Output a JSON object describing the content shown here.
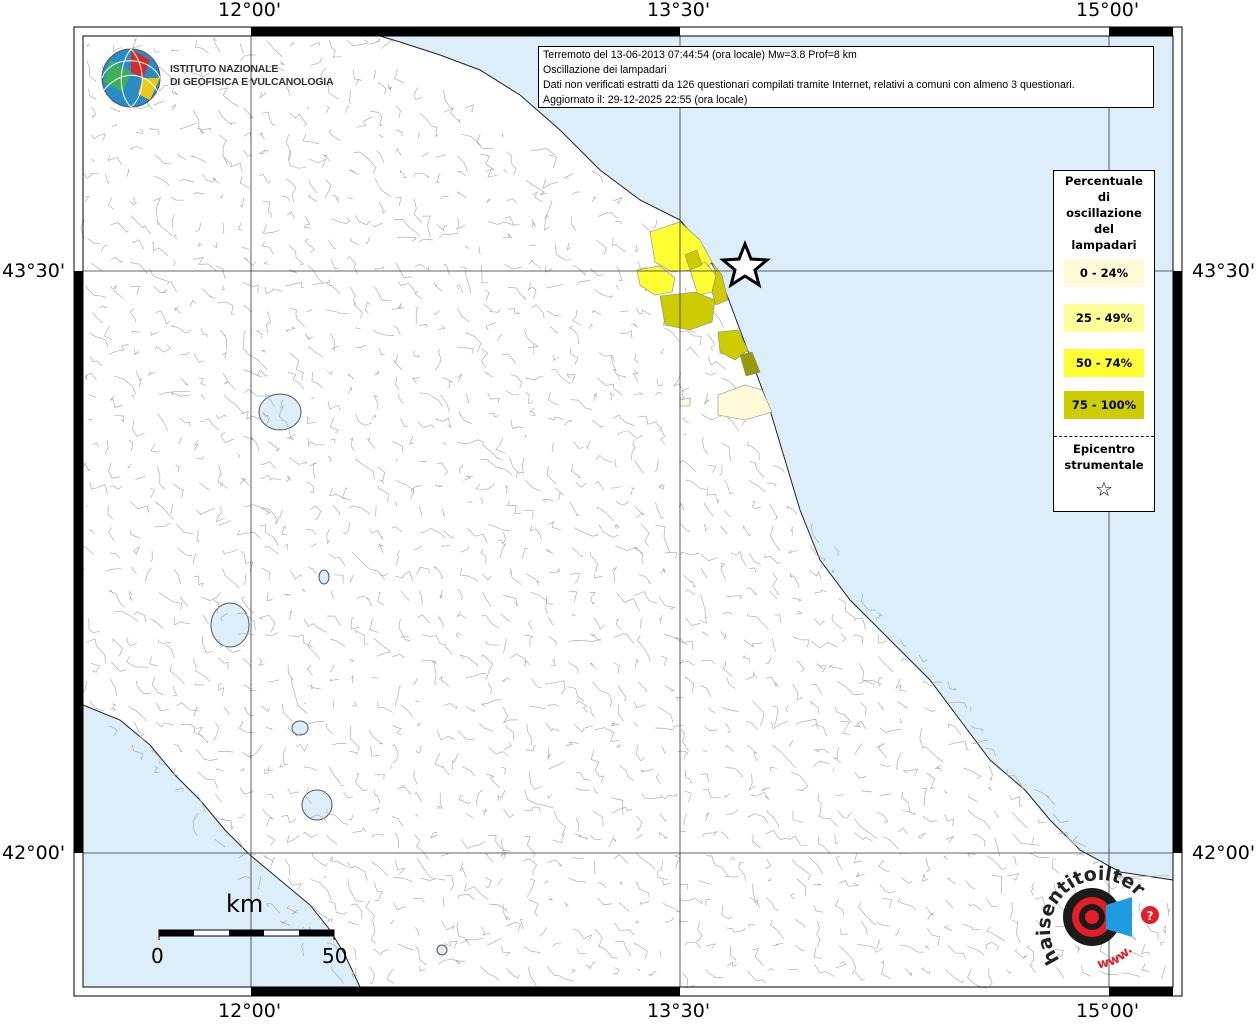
{
  "header": {
    "line1": "Terremoto del 13-06-2013 07:44:54 (ora locale) Mw=3.8 Prof=8 km",
    "line2": "Oscillazione dei lampadari",
    "line3": "Dati non verificati estratti da 126 questionari compilati tramite Internet, relativi a comuni con almeno 3 questionari.",
    "line4": "Aggiornato il: 29-12-2025 22:55 (ora locale)"
  },
  "logo": {
    "line1": "ISTITUTO NAZIONALE",
    "line2": "DI GEOFISICA E VULCANOLOGIA",
    "icon": "ingv-globe-icon"
  },
  "axes": {
    "top": [
      "12°00'",
      "13°30'",
      "15°00'"
    ],
    "bottom": [
      "12°00'",
      "13°30'",
      "15°00'"
    ],
    "left": [
      "43°30'",
      "42°00'"
    ],
    "right": [
      "43°30'",
      "42°00'"
    ]
  },
  "legend": {
    "title_lines": [
      "Percentuale",
      "di",
      "oscillazione",
      "del",
      "lampadari"
    ],
    "items": [
      {
        "label": "0 - 24%",
        "color": "#fffbd9"
      },
      {
        "label": "25 - 49%",
        "color": "#ffff99"
      },
      {
        "label": "50 - 74%",
        "color": "#ffff33"
      },
      {
        "label": "75 - 100%",
        "color": "#cccc00"
      }
    ],
    "epicenter_lines": [
      "Epicentro",
      "strumentale"
    ],
    "epicenter_symbol": "☆"
  },
  "scale": {
    "unit": "km",
    "start": "0",
    "end": "50"
  },
  "watermark": {
    "text": "haisentitoilterremoto.it",
    "url_text": "www.",
    "icon": "megaphone-target-icon"
  },
  "colors": {
    "sea": "#dbeefa",
    "land": "#ffffff",
    "border": "#999999"
  }
}
